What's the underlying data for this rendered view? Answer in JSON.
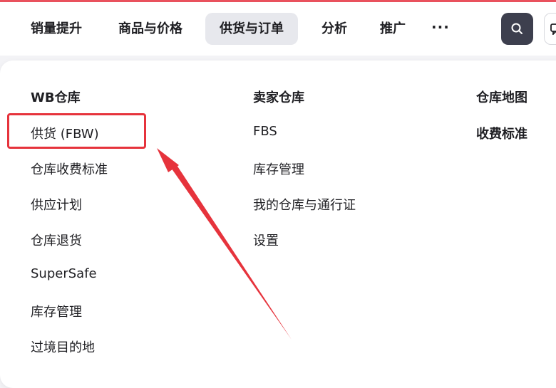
{
  "nav": {
    "items": [
      {
        "label": "销量提升",
        "active": false
      },
      {
        "label": "商品与价格",
        "active": false
      },
      {
        "label": "供货与订单",
        "active": true
      },
      {
        "label": "分析",
        "active": false
      },
      {
        "label": "推广",
        "active": false
      }
    ],
    "more_label": "···",
    "search_icon": "search-icon"
  },
  "menu": {
    "columns": [
      {
        "heading": "WB仓库",
        "items": [
          "供货 (FBW)",
          "仓库收费标准",
          "供应计划",
          "仓库退货",
          "SuperSafe",
          "库存管理",
          "过境目的地"
        ]
      },
      {
        "heading": "卖家仓库",
        "items": [
          "FBS",
          "库存管理",
          "我的仓库与通行证",
          "设置"
        ]
      },
      {
        "heading": "仓库地图",
        "items": [
          "收费标准"
        ]
      }
    ]
  },
  "annotation": {
    "highlighted_item": "供货 (FBW)",
    "color": "#e6333c"
  },
  "colors": {
    "accent_top": "#e9515d",
    "active_tab_bg": "#e7e8ed",
    "search_button_bg": "#3d3f4e",
    "page_bg": "#f3f3f6"
  }
}
